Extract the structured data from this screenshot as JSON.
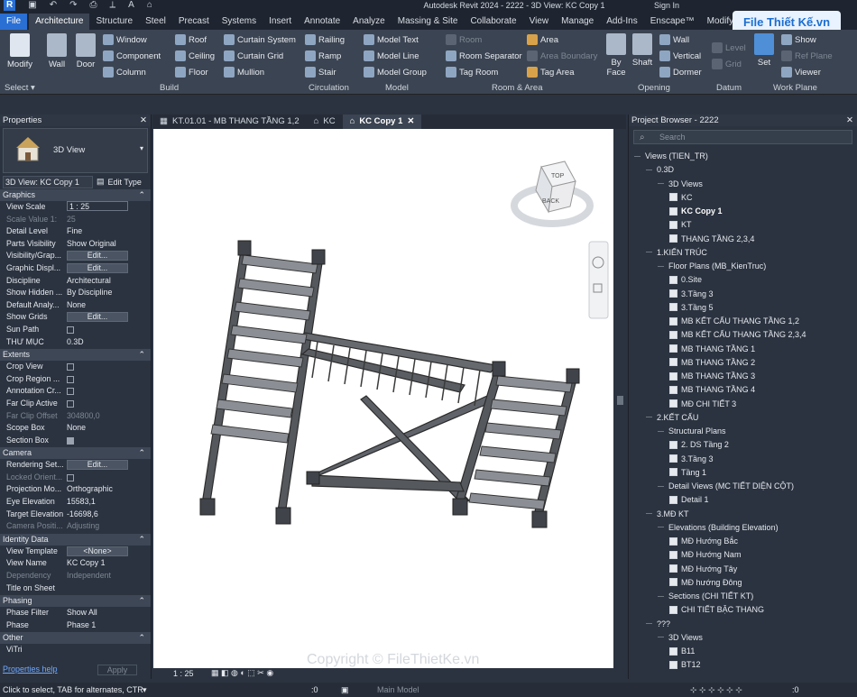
{
  "title": "Autodesk Revit 2024 - 2222 - 3D View: KC Copy 1",
  "signin": "Sign In",
  "tabs": [
    "File",
    "Architecture",
    "Structure",
    "Steel",
    "Precast",
    "Systems",
    "Insert",
    "Annotate",
    "Analyze",
    "Massing & Site",
    "Collaborate",
    "View",
    "Manage",
    "Add-Ins",
    "Enscape™",
    "Modify"
  ],
  "ribbon": {
    "modify": "Modify",
    "select": "Select",
    "wall": "Wall",
    "door": "Door",
    "build": [
      "Window",
      "Component",
      "Column",
      "Roof",
      "Ceiling",
      "Floor",
      "Curtain System",
      "Curtain Grid",
      "Mullion"
    ],
    "build_label": "Build",
    "circ": [
      "Railing",
      "Ramp",
      "Stair"
    ],
    "circ_label": "Circulation",
    "model": [
      "Model Text",
      "Model Line",
      "Model Group"
    ],
    "model_label": "Model",
    "room": [
      "Room",
      "Room Separator",
      "Tag Room",
      "Area",
      "Area Boundary",
      "Tag Area"
    ],
    "room_label": "Room & Area",
    "opening": [
      "By Face",
      "Shaft",
      "Wall",
      "Vertical",
      "Dormer"
    ],
    "opening_label": "Opening",
    "datum": [
      "Level",
      "Grid"
    ],
    "datum_label": "Datum",
    "wp": [
      "Set",
      "Show",
      "Ref Plane",
      "Viewer"
    ],
    "wp_label": "Work Plane"
  },
  "properties": {
    "header": "Properties",
    "type": "3D View",
    "selector": "3D View: KC Copy 1",
    "edit_type": "Edit Type",
    "sections": [
      {
        "name": "Graphics",
        "rows": [
          [
            "View Scale",
            "1 : 25",
            "box"
          ],
          [
            "Scale Value 1:",
            "25",
            "dis"
          ],
          [
            "Detail Level",
            "Fine",
            ""
          ],
          [
            "Parts Visibility",
            "Show Original",
            ""
          ],
          [
            "Visibility/Grap...",
            "Edit...",
            "btn"
          ],
          [
            "Graphic Displ...",
            "Edit...",
            "btn"
          ],
          [
            "Discipline",
            "Architectural",
            ""
          ],
          [
            "Show Hidden ...",
            "By Discipline",
            ""
          ],
          [
            "Default Analy...",
            "None",
            ""
          ],
          [
            "Show Grids",
            "Edit...",
            "btn"
          ],
          [
            "Sun Path",
            "",
            "chk"
          ],
          [
            "THƯ MỤC",
            "0.3D",
            ""
          ]
        ]
      },
      {
        "name": "Extents",
        "rows": [
          [
            "Crop View",
            "",
            "chk"
          ],
          [
            "Crop Region ...",
            "",
            "chk"
          ],
          [
            "Annotation Cr...",
            "",
            "chk"
          ],
          [
            "Far Clip Active",
            "",
            "chk"
          ],
          [
            "Far Clip Offset",
            "304800,0",
            "dis"
          ],
          [
            "Scope Box",
            "None",
            ""
          ],
          [
            "Section Box",
            "",
            "chkon"
          ]
        ]
      },
      {
        "name": "Camera",
        "rows": [
          [
            "Rendering Set...",
            "Edit...",
            "btn"
          ],
          [
            "Locked Orient...",
            "",
            "dischk"
          ],
          [
            "Projection Mo...",
            "Orthographic",
            ""
          ],
          [
            "Eye Elevation",
            "15583,1",
            ""
          ],
          [
            "Target Elevation",
            "-16698,6",
            ""
          ],
          [
            "Camera Positi...",
            "Adjusting",
            "dis"
          ]
        ]
      },
      {
        "name": "Identity Data",
        "rows": [
          [
            "View Template",
            "<None>",
            "btn"
          ],
          [
            "View Name",
            "KC Copy 1",
            ""
          ],
          [
            "Dependency",
            "Independent",
            "dis"
          ],
          [
            "Title on Sheet",
            "",
            ""
          ]
        ]
      },
      {
        "name": "Phasing",
        "rows": [
          [
            "Phase Filter",
            "Show All",
            ""
          ],
          [
            "Phase",
            "Phase 1",
            ""
          ]
        ]
      },
      {
        "name": "Other",
        "rows": [
          [
            "ViTri",
            "",
            ""
          ]
        ]
      }
    ],
    "help": "Properties help",
    "apply": "Apply"
  },
  "view_tabs": [
    "KT.01.01 - MB THANG TẦNG 1,2",
    "KC",
    "KC Copy 1"
  ],
  "view_scale": "1 : 25",
  "browser": {
    "header": "Project Browser - 2222",
    "search": "Search",
    "nodes": [
      [
        "Views (TIEN_TR)",
        0,
        "root"
      ],
      [
        "0.3D",
        1,
        "g"
      ],
      [
        "3D Views",
        2,
        "g"
      ],
      [
        "KC",
        3,
        "v"
      ],
      [
        "KC Copy 1",
        3,
        "vb"
      ],
      [
        "KT",
        3,
        "v"
      ],
      [
        "THANG TẦNG 2,3,4",
        3,
        "v"
      ],
      [
        "1.KIẾN TRÚC",
        1,
        "g"
      ],
      [
        "Floor Plans (MB_KienTruc)",
        2,
        "g"
      ],
      [
        "0.Site",
        3,
        "v"
      ],
      [
        "3.Tầng 3",
        3,
        "v"
      ],
      [
        "3.Tầng 5",
        3,
        "v"
      ],
      [
        "MB KẾT CẤU THANG TẦNG 1,2",
        3,
        "v"
      ],
      [
        "MB KẾT CẤU THANG TẦNG 2,3,4",
        3,
        "v"
      ],
      [
        "MB THANG TẦNG 1",
        3,
        "v"
      ],
      [
        "MB THANG TẦNG 2",
        3,
        "v"
      ],
      [
        "MB THANG TẦNG 3",
        3,
        "v"
      ],
      [
        "MB THANG TẦNG 4",
        3,
        "v"
      ],
      [
        "MĐ CHI TIẾT 3",
        3,
        "v"
      ],
      [
        "2.KẾT CẤU",
        1,
        "g"
      ],
      [
        "Structural Plans",
        2,
        "g"
      ],
      [
        "2. DS Tầng 2",
        3,
        "v"
      ],
      [
        "3.Tầng 3",
        3,
        "v"
      ],
      [
        "Tầng 1",
        3,
        "v"
      ],
      [
        "Detail Views (MC TIẾT DIỆN CỘT)",
        2,
        "g"
      ],
      [
        "Detail 1",
        3,
        "v"
      ],
      [
        "3.MĐ KT",
        1,
        "g"
      ],
      [
        "Elevations (Building Elevation)",
        2,
        "g"
      ],
      [
        "MĐ Hướng Bắc",
        3,
        "v"
      ],
      [
        "MĐ Hướng Nam",
        3,
        "v"
      ],
      [
        "MĐ Hướng Tây",
        3,
        "v"
      ],
      [
        "MĐ hướng Đông",
        3,
        "v"
      ],
      [
        "Sections (CHI TIẾT KT)",
        2,
        "g"
      ],
      [
        "CHI TIẾT BẬC THANG",
        3,
        "v"
      ],
      [
        "???",
        1,
        "g"
      ],
      [
        "3D Views",
        2,
        "g"
      ],
      [
        "B11",
        3,
        "v"
      ],
      [
        "BT12",
        3,
        "v"
      ]
    ]
  },
  "status": "Click to select, TAB for alternates, CTR",
  "status_model": "Main Model",
  "status_count": ":0",
  "watermark": "Copyright © FileThietKe.vn",
  "logo": "File Thiết Kế.vn",
  "viewcube_face": "BACK",
  "viewcube_top": "TOP"
}
